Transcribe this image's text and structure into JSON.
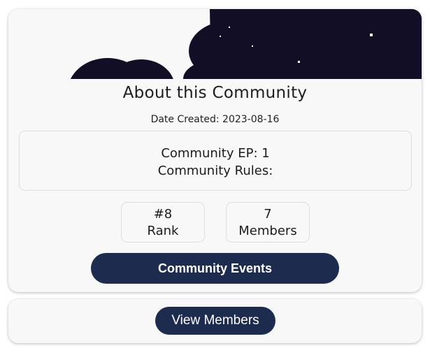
{
  "about": {
    "title": "About this Community",
    "date_created": "Date Created: 2023-08-16",
    "community_ep": "Community EP: 1",
    "community_rules": "Community Rules:",
    "rank_value": "#8",
    "rank_label": "Rank",
    "members_value": "7",
    "members_label": "Members",
    "events_button": "Community Events"
  },
  "members_section": {
    "view_members_button": "View Members"
  },
  "colors": {
    "card_background": "#f8f8f8",
    "banner_night_sky": "#120e25",
    "button_navy": "#1c2b4e"
  }
}
